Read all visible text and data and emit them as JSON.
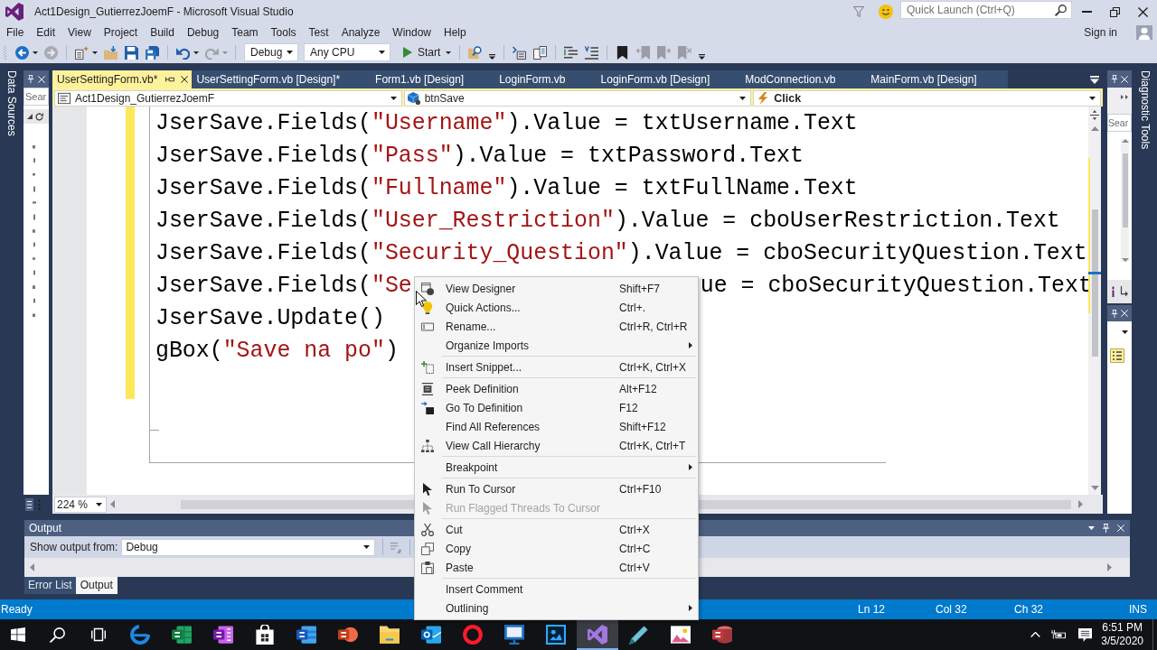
{
  "window": {
    "title": "Act1Design_GutierrezJoemF - Microsoft Visual Studio",
    "quick_launch": {
      "placeholder": "Quick Launch (Ctrl+Q)"
    }
  },
  "menu": [
    "File",
    "Edit",
    "View",
    "Project",
    "Build",
    "Debug",
    "Team",
    "Tools",
    "Test",
    "Analyze",
    "Window",
    "Help"
  ],
  "account": {
    "label": "Sign in"
  },
  "toolbar": {
    "left_buttons": [
      {
        "disabled": false
      },
      {
        "disabled": true
      },
      {
        "disabled": false
      },
      {
        "disabled": false
      },
      {
        "disabled": false
      },
      {
        "disabled": false
      },
      {
        "disabled": false
      },
      {
        "disabled": true
      }
    ],
    "configuration": "Debug",
    "platform": "Any CPU",
    "start_label": "Start",
    "right_buttons": [
      {
        "disabled": false
      },
      {
        "disabled": false
      },
      {
        "disabled": false
      },
      {
        "disabled": false
      },
      {
        "disabled": false
      },
      {
        "disabled": false
      },
      {
        "disabled": true
      },
      {
        "disabled": true
      },
      {
        "disabled": true
      }
    ]
  },
  "side_tabs": {
    "left": "Data Sources",
    "right": "Diagnostic Tools"
  },
  "left_panel": {
    "search": {
      "placeholder": "Sear"
    }
  },
  "right_panel": {
    "search": {
      "placeholder": "Sear"
    }
  },
  "document_tabs": [
    {
      "label": "UserSettingForm.vb*",
      "selected": true
    },
    {
      "label": "UserSettingForm.vb [Design]*",
      "selected": false
    },
    {
      "label": "Form1.vb [Design]",
      "selected": false
    },
    {
      "label": "LoginForm.vb",
      "selected": false
    },
    {
      "label": "LoginForm.vb [Design]",
      "selected": false
    },
    {
      "label": "ModConnection.vb",
      "selected": false
    },
    {
      "label": "MainForm.vb [Design]",
      "selected": false
    }
  ],
  "navigation_bar": {
    "project": "Act1Design_GutierrezJoemF",
    "object": "btnSave",
    "member": "Click"
  },
  "editor": {
    "lines": [
      {
        "segments": [
          {
            "text": "JserSave.Fields(",
            "kind": "plain"
          },
          {
            "text": "\"Username\"",
            "kind": "string"
          },
          {
            "text": ").Value = txtUsername.Text",
            "kind": "plain"
          }
        ],
        "changed": true
      },
      {
        "segments": [
          {
            "text": "JserSave.Fields(",
            "kind": "plain"
          },
          {
            "text": "\"Pass\"",
            "kind": "string"
          },
          {
            "text": ").Value = txtPassword.Text",
            "kind": "plain"
          }
        ],
        "changed": true
      },
      {
        "segments": [
          {
            "text": "JserSave.Fields(",
            "kind": "plain"
          },
          {
            "text": "\"Fullname\"",
            "kind": "string"
          },
          {
            "text": ").Value = txtFullName.Text",
            "kind": "plain"
          }
        ],
        "changed": true
      },
      {
        "segments": [
          {
            "text": "JserSave.Fields(",
            "kind": "plain"
          },
          {
            "text": "\"User_Restriction\"",
            "kind": "string"
          },
          {
            "text": ").Value = cboUserRestriction.Text",
            "kind": "plain"
          }
        ],
        "changed": true
      },
      {
        "segments": [
          {
            "text": "JserSave.Fields(",
            "kind": "plain"
          },
          {
            "text": "\"Security_Question\"",
            "kind": "string"
          },
          {
            "text": ").Value = cboSecurityQuestion.Text",
            "kind": "plain"
          }
        ],
        "changed": true
      },
      {
        "segments": [
          {
            "text": "JserSave.Fields(",
            "kind": "plain"
          },
          {
            "text": "\"Se",
            "kind": "string"
          }
        ],
        "segments_right_of_menu": [
          {
            "text": "ue = cboSecurityQuestion.Text",
            "kind": "plain"
          }
        ],
        "changed": true
      },
      {
        "segments": [
          {
            "text": "JserSave.Update()",
            "kind": "plain"
          }
        ],
        "changed": true
      },
      {
        "segments": [
          {
            "text": "gBox(",
            "kind": "plain"
          },
          {
            "text": "\"Save na po\"",
            "kind": "string"
          },
          {
            "text": ")",
            "kind": "plain"
          }
        ],
        "changed": true
      },
      {
        "changed": true
      }
    ],
    "zoom": "224 %"
  },
  "context_menu": {
    "groups": [
      [
        {
          "label": "View Designer",
          "shortcut": "Shift+F7",
          "submenu": false,
          "disabled": false
        },
        {
          "label": "Quick Actions...",
          "shortcut": "Ctrl+.",
          "submenu": false,
          "disabled": false
        },
        {
          "label": "Rename...",
          "shortcut": "Ctrl+R, Ctrl+R",
          "submenu": false,
          "disabled": false
        },
        {
          "label": "Organize Imports",
          "submenu": true,
          "disabled": false
        }
      ],
      [
        {
          "label": "Insert Snippet...",
          "shortcut": "Ctrl+K, Ctrl+X",
          "submenu": false,
          "disabled": false
        }
      ],
      [
        {
          "label": "Peek Definition",
          "shortcut": "Alt+F12",
          "submenu": false,
          "disabled": false
        },
        {
          "label": "Go To Definition",
          "shortcut": "F12",
          "submenu": false,
          "disabled": false
        },
        {
          "label": "Find All References",
          "shortcut": "Shift+F12",
          "submenu": false,
          "disabled": false
        },
        {
          "label": "View Call Hierarchy",
          "shortcut": "Ctrl+K, Ctrl+T",
          "submenu": false,
          "disabled": false
        }
      ],
      [
        {
          "label": "Breakpoint",
          "submenu": true,
          "disabled": false
        }
      ],
      [
        {
          "label": "Run To Cursor",
          "shortcut": "Ctrl+F10",
          "submenu": false,
          "disabled": false
        },
        {
          "label": "Run Flagged Threads To Cursor",
          "submenu": false,
          "disabled": true
        }
      ],
      [
        {
          "label": "Cut",
          "shortcut": "Ctrl+X",
          "submenu": false,
          "disabled": false
        },
        {
          "label": "Copy",
          "shortcut": "Ctrl+C",
          "submenu": false,
          "disabled": false
        },
        {
          "label": "Paste",
          "shortcut": "Ctrl+V",
          "submenu": false,
          "disabled": false
        }
      ],
      [
        {
          "label": "Insert Comment",
          "submenu": false,
          "disabled": false
        },
        {
          "label": "Outlining",
          "submenu": true,
          "disabled": false
        }
      ]
    ]
  },
  "output_panel": {
    "title": "Output",
    "source_label": "Show output from:",
    "source": "Debug",
    "buttons": [
      {
        "disabled": true
      }
    ]
  },
  "bottom_tabs": [
    {
      "label": "Error List",
      "selected": false
    },
    {
      "label": "Output",
      "selected": true
    }
  ],
  "status_bar": {
    "message": "Ready",
    "line": "Ln 12",
    "column": "Col 32",
    "character": "Ch 32",
    "mode": "INS"
  },
  "taskbar": {
    "apps": [
      {
        "selected": false
      },
      {
        "selected": false
      },
      {
        "selected": false
      },
      {
        "selected": false
      },
      {
        "selected": false
      },
      {
        "selected": false
      },
      {
        "selected": false
      },
      {
        "selected": false
      },
      {
        "selected": false
      },
      {
        "selected": false
      },
      {
        "selected": false
      },
      {
        "selected": true
      },
      {
        "selected": false
      },
      {
        "selected": false
      },
      {
        "selected": false
      }
    ],
    "clock": {
      "time": "6:51 PM",
      "date": "3/5/2020"
    }
  }
}
